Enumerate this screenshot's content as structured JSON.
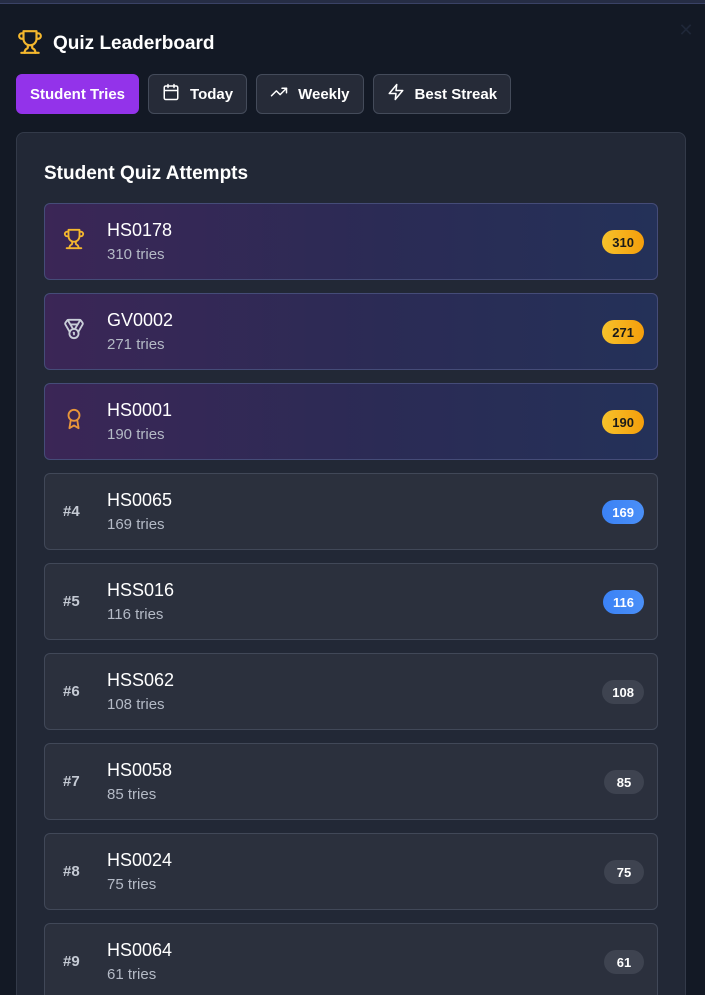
{
  "header": {
    "title": "Quiz Leaderboard",
    "icon": "trophy-icon",
    "accent": "#f5b82e"
  },
  "tabs": [
    {
      "label": "Student Tries",
      "icon": "",
      "active": true
    },
    {
      "label": "Today",
      "icon": "calendar-icon",
      "active": false
    },
    {
      "label": "Weekly",
      "icon": "trending-up-icon",
      "active": false
    },
    {
      "label": "Best Streak",
      "icon": "lightning-icon",
      "active": false
    }
  ],
  "panel": {
    "title": "Student Quiz Attempts"
  },
  "rows": [
    {
      "rank": "",
      "icon": "trophy-icon",
      "name": "HS0178",
      "tries": "310 tries",
      "count": "310",
      "style": "top",
      "badge": "gold"
    },
    {
      "rank": "",
      "icon": "medal-icon",
      "name": "GV0002",
      "tries": "271 tries",
      "count": "271",
      "style": "top",
      "badge": "gold"
    },
    {
      "rank": "",
      "icon": "award-icon",
      "name": "HS0001",
      "tries": "190 tries",
      "count": "190",
      "style": "top",
      "badge": "gold"
    },
    {
      "rank": "#4",
      "icon": "",
      "name": "HS0065",
      "tries": "169 tries",
      "count": "169",
      "style": "normal",
      "badge": "blue"
    },
    {
      "rank": "#5",
      "icon": "",
      "name": "HSS016",
      "tries": "116 tries",
      "count": "116",
      "style": "normal",
      "badge": "blue"
    },
    {
      "rank": "#6",
      "icon": "",
      "name": "HSS062",
      "tries": "108 tries",
      "count": "108",
      "style": "normal",
      "badge": "gray"
    },
    {
      "rank": "#7",
      "icon": "",
      "name": "HS0058",
      "tries": "85 tries",
      "count": "85",
      "style": "normal",
      "badge": "gray"
    },
    {
      "rank": "#8",
      "icon": "",
      "name": "HS0024",
      "tries": "75 tries",
      "count": "75",
      "style": "normal",
      "badge": "gray"
    },
    {
      "rank": "#9",
      "icon": "",
      "name": "HS0064",
      "tries": "61 tries",
      "count": "61",
      "style": "normal",
      "badge": "gray"
    }
  ]
}
